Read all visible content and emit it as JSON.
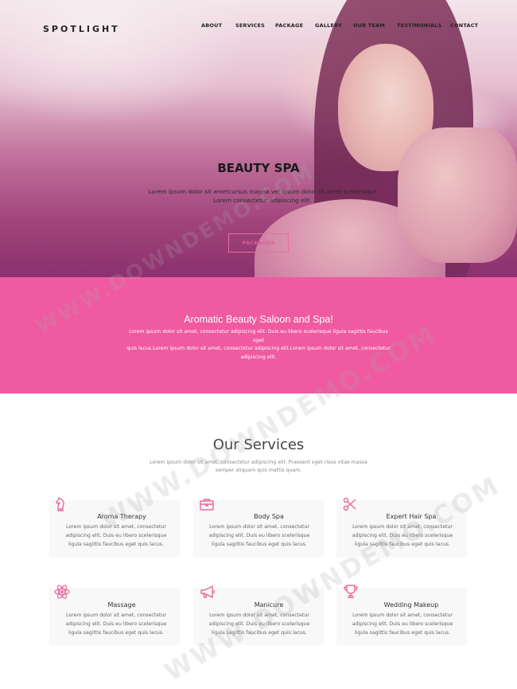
{
  "header": {
    "logo": "SPOTLIGHT",
    "nav": [
      "ABOUT",
      "SERVICES",
      "PACKAGE",
      "GALLERY",
      "OUR TEAM",
      "TESTIMONIALS",
      "CONTACT"
    ]
  },
  "hero": {
    "title": "BEAUTY SPA",
    "text_line1": "Lorem ipsum dolor sit ametcursus magna vel ipsum dolor sit amet scelerisque",
    "text_line2": "Lorem consectetur adipiscing elit.",
    "button": "PACKAGES"
  },
  "band": {
    "title": "Aromatic Beauty Saloon and Spa!",
    "text_line1": "Lorem ipsum dolor sit amet, consectetur adipiscing elit. Duis eu libero scelerisque ligula sagittis faucibus eget",
    "text_line2": "quis lacus.Lorem ipsum dolor sit amet, consectetur adipiscing elit.Lorem ipsum dolor sit amet, consectetur",
    "text_line3": "adipiscing elit."
  },
  "services": {
    "title": "Our Services",
    "subtitle_line1": "Lorem ipsum dolor sit amet, consectetur adipiscing elit. Praesent eget risus vitae massa",
    "subtitle_line2": "semper aliquam quis mattis quam.",
    "card_text_line1": "Lorem ipsum dolor sit amet, consectetur",
    "card_text_line2": "adipiscing elit. Duis eu libero scelerisque",
    "card_text_line3": "ligula sagittis faucibus eget quis lacus.",
    "items": [
      {
        "title": "Aroma Therapy",
        "icon": "chess-knight-icon"
      },
      {
        "title": "Body Spa",
        "icon": "briefcase-icon"
      },
      {
        "title": "Expert Hair Spa",
        "icon": "scissors-icon"
      },
      {
        "title": "Massage",
        "icon": "atom-icon"
      },
      {
        "title": "Manicure",
        "icon": "megaphone-icon"
      },
      {
        "title": "Wedding Makeup",
        "icon": "trophy-icon"
      }
    ]
  },
  "watermark": {
    "text1": "WWW.DOWNDEMO.COM",
    "text2": "WWW.DOWNDEMO.COM",
    "text3": "WWW.DOWNDEMO.COM"
  },
  "colors": {
    "accent": "#ef5aa1",
    "button_border": "#e5709f",
    "icon": "#e8679c"
  }
}
